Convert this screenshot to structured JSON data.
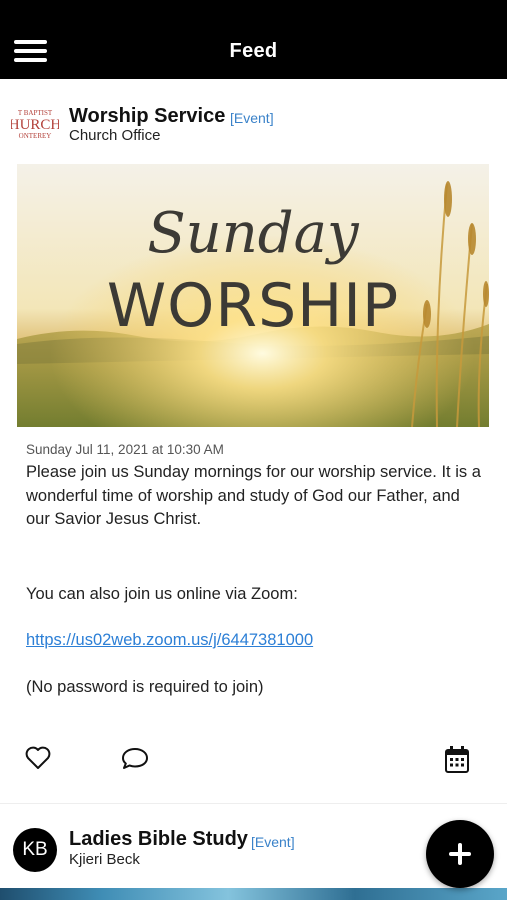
{
  "header": {
    "title": "Feed"
  },
  "post1": {
    "title": "Worship Service",
    "tag": "[Event]",
    "author": "Church Office",
    "logo_lines": [
      "T BAPTIST",
      "HURCH",
      "ONTEREY"
    ],
    "image_text": {
      "line1": "Sunday",
      "line2": "WORSHIP"
    },
    "date": "Sunday Jul 11, 2021 at 10:30 AM",
    "paragraph1": "Please join us Sunday mornings for our worship service. It is a wonderful time of worship and study of God our Father, and our Savior Jesus Christ.",
    "paragraph2": "You can also join us online via Zoom:",
    "link": "https://us02web.zoom.us/j/6447381000",
    "paragraph3": "(No password is required to join)"
  },
  "post2": {
    "title": "Ladies Bible Study",
    "tag": "[Event]",
    "author": "Kjieri Beck",
    "avatar_initials": "KB"
  },
  "icons": {
    "menu": "hamburger-icon",
    "like": "heart-icon",
    "comment": "comment-icon",
    "calendar": "calendar-icon",
    "add": "plus-icon"
  },
  "colors": {
    "tag": "#3a82c9",
    "link": "#2c7fd6",
    "header_bg": "#000000"
  }
}
